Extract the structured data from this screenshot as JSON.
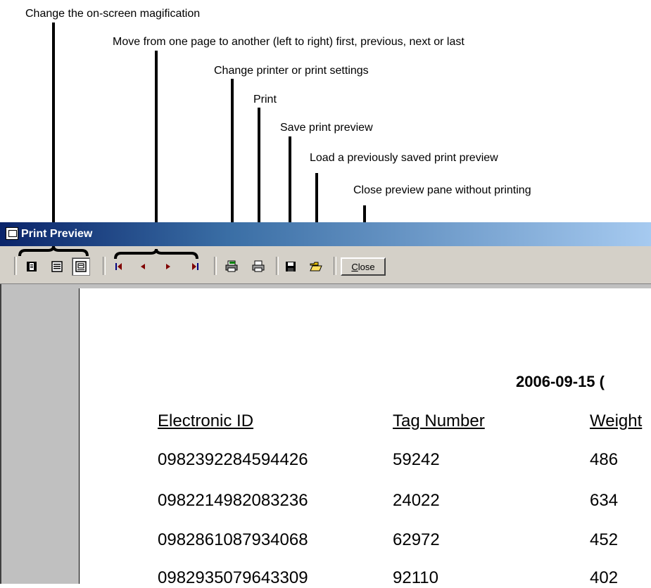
{
  "callouts": {
    "magnification": "Change the on-screen magification",
    "navigate": "Move from one page to another (left to right) first, previous, next or last",
    "printer_settings": "Change printer or print settings",
    "print": "Print",
    "save": "Save print preview",
    "load": "Load a previously saved  print preview",
    "close": "Close preview pane without printing"
  },
  "window": {
    "title": "Print Preview"
  },
  "toolbar": {
    "close_label_underlined": "C",
    "close_label_rest": "lose",
    "icons": [
      "one-page-view-icon",
      "multi-page-view-icon",
      "zoom-view-icon",
      "first-page-icon",
      "previous-page-icon",
      "next-page-icon",
      "last-page-icon",
      "printer-settings-icon",
      "print-icon",
      "save-icon",
      "open-folder-icon"
    ]
  },
  "report": {
    "title": "2006-09-15 (",
    "columns": [
      "Electronic ID",
      "Tag Number",
      "Weight"
    ],
    "rows": [
      [
        "0982392284594426",
        "59242",
        "486"
      ],
      [
        "0982214982083236",
        "24022",
        "634"
      ],
      [
        "0982861087934068",
        "62972",
        "452"
      ],
      [
        "0982935079643309",
        "92110",
        "402"
      ]
    ]
  }
}
